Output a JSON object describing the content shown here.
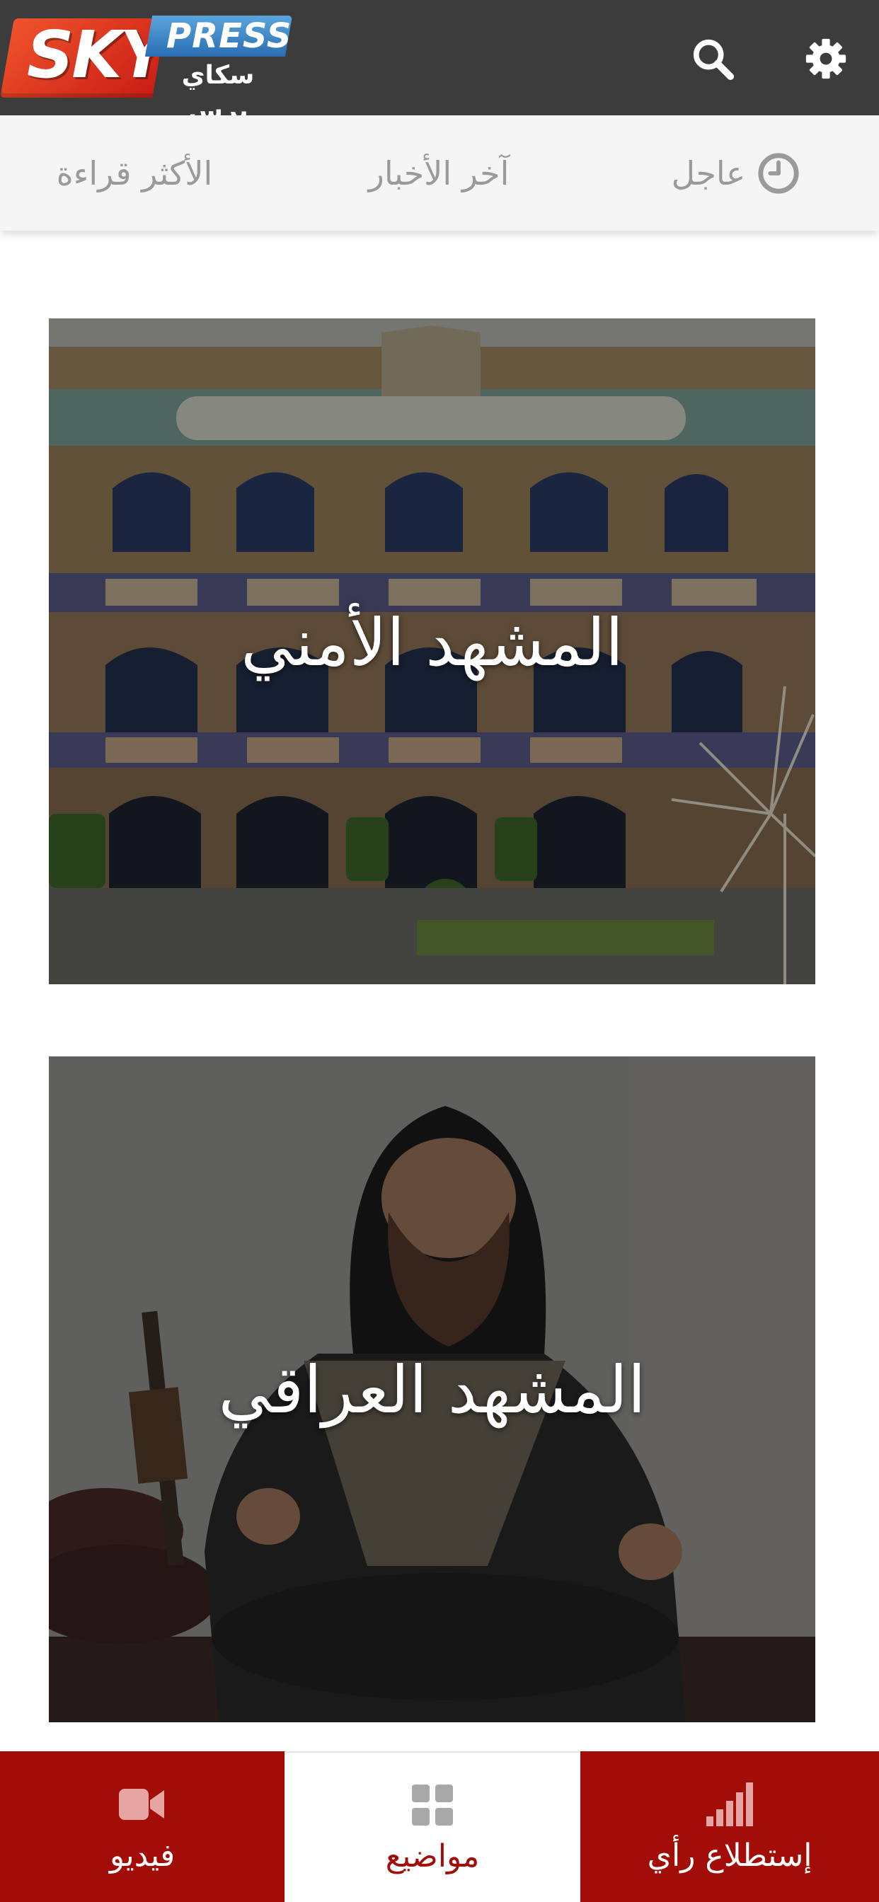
{
  "header": {
    "logo_sky": "SKY",
    "logo_press": "PRESS",
    "logo_arabic": "سكاي برس",
    "search_icon": "search-icon",
    "settings_icon": "gear-icon"
  },
  "tabs": {
    "urgent": "عاجل",
    "latest": "آخر الأخبار",
    "most_read": "الأكثر قراءة"
  },
  "cards": [
    {
      "title": "المشهد الأمني"
    },
    {
      "title": "المشهد العراقي"
    }
  ],
  "bottom_nav": {
    "video": "فيديو",
    "topics": "مواضيع",
    "poll": "إستطلاع رأي"
  },
  "colors": {
    "appbar": "#3c3c3c",
    "brand_red": "#a20d07",
    "tab_text": "#9a9a9a"
  }
}
